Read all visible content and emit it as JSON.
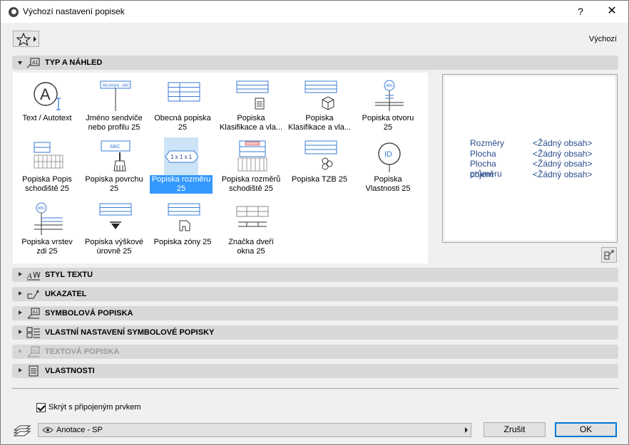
{
  "window": {
    "title": "Výchozí nastavení popisek",
    "help": "?",
    "close": "✕"
  },
  "favorites": {
    "label": "Výchozí"
  },
  "panels": {
    "type_preview": "TYP A NÁHLED",
    "text_style": "STYL TEXTU",
    "pointer": "UKAZATEL",
    "symbol_label": "SYMBOLOVÁ POPISKA",
    "custom_symbol": "VLASTNÍ NASTAVENÍ SYMBOLOVÉ POPISKY",
    "text_label": "TEXTOVÁ POPISKA",
    "properties": "VLASTNOSTI"
  },
  "label_types": [
    {
      "line1": "Text / Autotext",
      "line2": "",
      "icon": "text-autotext-icon"
    },
    {
      "line1": "Jméno sendviče",
      "line2": "nebo profilu 25",
      "icon": "composite-name-icon"
    },
    {
      "line1": "Obecná popiska",
      "line2": "25",
      "icon": "general-label-icon"
    },
    {
      "line1": "Popiska",
      "line2": "Klasifikace a vla...",
      "icon": "classification-label-icon"
    },
    {
      "line1": "Popiska",
      "line2": "Klasifikace a vla...",
      "icon": "classification-3d-label-icon"
    },
    {
      "line1": "Popiska otvoru",
      "line2": "25",
      "icon": "opening-label-icon"
    },
    {
      "line1": "Popiska Popis",
      "line2": "schodiště 25",
      "icon": "stair-description-icon"
    },
    {
      "line1": "Popiska povrchu",
      "line2": "25",
      "icon": "surface-label-icon"
    },
    {
      "line1": "Popiska rozměru",
      "line2": "25",
      "icon": "dimension-label-icon"
    },
    {
      "line1": "Popiska rozměrů",
      "line2": "schodiště 25",
      "icon": "stair-dimension-icon"
    },
    {
      "line1": "Popiska TZB 25",
      "line2": "",
      "icon": "mep-label-icon"
    },
    {
      "line1": "Popiska",
      "line2": "Vlastnosti 25",
      "icon": "property-label-icon"
    },
    {
      "line1": "Popiska vrstev",
      "line2": "zdi 25",
      "icon": "wall-layers-icon"
    },
    {
      "line1": "Popiska výškové",
      "line2": "úrovně 25",
      "icon": "elevation-label-icon"
    },
    {
      "line1": "Popiska zóny 25",
      "line2": "",
      "icon": "zone-label-icon"
    },
    {
      "line1": "Značka dveří",
      "line2": "okna 25",
      "icon": "door-window-marker-icon"
    }
  ],
  "thumb_texts": {
    "composite": "Abcdefghij - ABC",
    "surface": "ABC",
    "dimension": "1 x 1 x 1",
    "opening": "ABC",
    "property": "ID",
    "wall_layers": "ABC"
  },
  "preview": {
    "rows": [
      {
        "key": "Rozměry",
        "value": "<Žádný obsah>"
      },
      {
        "key": "Plocha",
        "value": "<Žádný obsah>"
      },
      {
        "key": "Plocha průměru",
        "value": "<Žádný obsah>"
      },
      {
        "key": "objem",
        "value": "<Žádný obsah>"
      }
    ]
  },
  "footer": {
    "hide_checkbox_label": "Skrýt s připojeným prvkem",
    "layer_value": "Anotace - SP",
    "cancel": "Zrušit",
    "ok": "OK"
  },
  "colors": {
    "accent": "#3399ff",
    "selection_bg": "#cce4f7",
    "preview_text": "#2a4c8c"
  }
}
